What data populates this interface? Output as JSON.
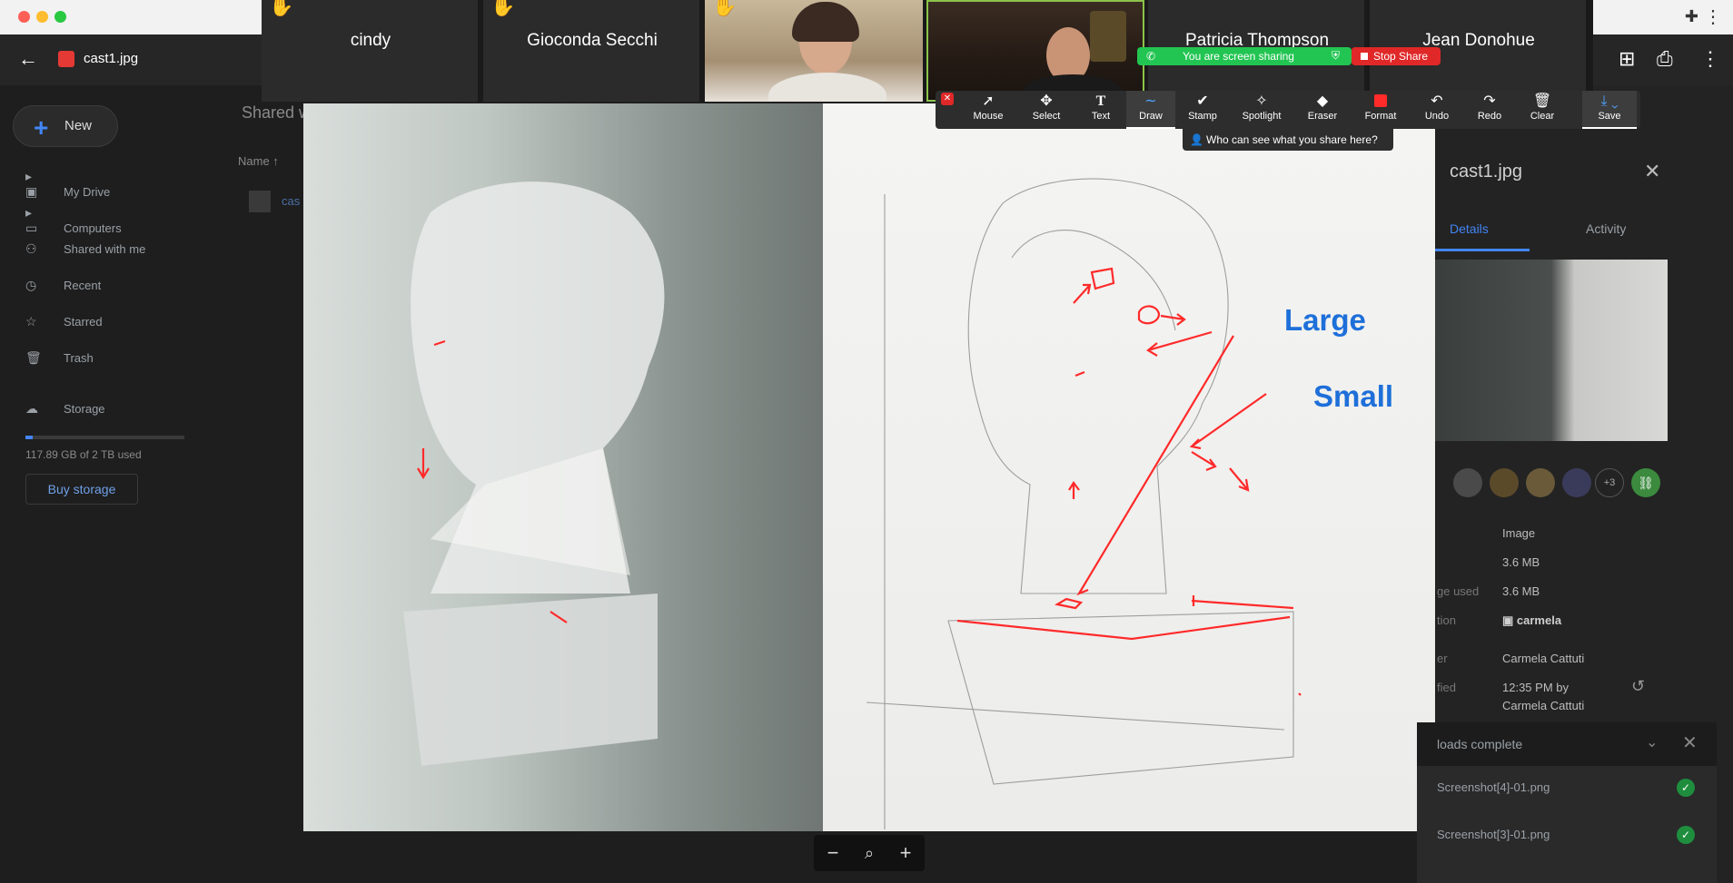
{
  "browser": {
    "extension_icon": "puzzle-icon",
    "menu_icon": "more-vert-icon"
  },
  "viewer": {
    "file_name": "cast1.jpg",
    "back_icon": "arrow-back-icon",
    "header_icons": [
      "add-comment-icon",
      "print-icon",
      "more-vert-icon"
    ]
  },
  "sidebar": {
    "new_label": "New",
    "items": [
      {
        "label": "My Drive",
        "icon": "drive-icon"
      },
      {
        "label": "Computers",
        "icon": "computer-icon"
      },
      {
        "label": "Shared with me",
        "icon": "people-icon"
      },
      {
        "label": "Recent",
        "icon": "clock-icon"
      },
      {
        "label": "Starred",
        "icon": "star-icon"
      },
      {
        "label": "Trash",
        "icon": "trash-icon"
      }
    ],
    "storage_label": "Storage",
    "storage_text": "117.89 GB of 2 TB used",
    "buy_storage": "Buy storage"
  },
  "file_list": {
    "title": "Shared w",
    "column_name": "Name",
    "row_name": "cas"
  },
  "zoom": {
    "participants": [
      {
        "name": "cindy",
        "hand": true
      },
      {
        "name": "Gioconda Secchi",
        "hand": true
      }
    ],
    "participants_right": [
      {
        "name": "Patricia Thompson"
      },
      {
        "name": "Jean Donohue"
      }
    ],
    "sharing_text": "You are screen sharing",
    "stop_share": "Stop Share",
    "who_can_see": "Who can see what you share here?",
    "tools": [
      {
        "label": "Mouse",
        "icon": "cursor-icon"
      },
      {
        "label": "Select",
        "icon": "move-icon"
      },
      {
        "label": "Text",
        "icon": "text-icon"
      },
      {
        "label": "Draw",
        "icon": "draw-icon",
        "active": true
      },
      {
        "label": "Stamp",
        "icon": "check-icon"
      },
      {
        "label": "Spotlight",
        "icon": "spotlight-icon"
      },
      {
        "label": "Eraser",
        "icon": "eraser-icon"
      },
      {
        "label": "Format",
        "icon": "format-icon"
      },
      {
        "label": "Undo",
        "icon": "undo-icon"
      },
      {
        "label": "Redo",
        "icon": "redo-icon"
      },
      {
        "label": "Clear",
        "icon": "trash-icon"
      },
      {
        "label": "Save",
        "icon": "save-icon"
      }
    ],
    "annotation_color": "#ff2a2a"
  },
  "annotations": {
    "large": "Large",
    "small": "Small",
    "text_color": "#1e6fd9"
  },
  "details": {
    "title": "cast1.jpg",
    "tab_details": "Details",
    "tab_activity": "Activity",
    "more_count": "+3",
    "rows": [
      {
        "label": "",
        "value": "Image"
      },
      {
        "label": "",
        "value": "3.6 MB"
      },
      {
        "label": "ge used",
        "value": "3.6 MB"
      },
      {
        "label": "tion",
        "value": "carmela"
      },
      {
        "label": "er",
        "value": "Carmela Cattuti"
      },
      {
        "label": "fied",
        "value": "12:35 PM by"
      },
      {
        "label": "",
        "value": "Carmela Cattuti"
      }
    ]
  },
  "downloads": {
    "title": "loads complete",
    "items": [
      "Screenshot[4]-01.png",
      "Screenshot[3]-01.png"
    ]
  },
  "zoom_controls": {
    "minus": "−",
    "plus": "+"
  }
}
